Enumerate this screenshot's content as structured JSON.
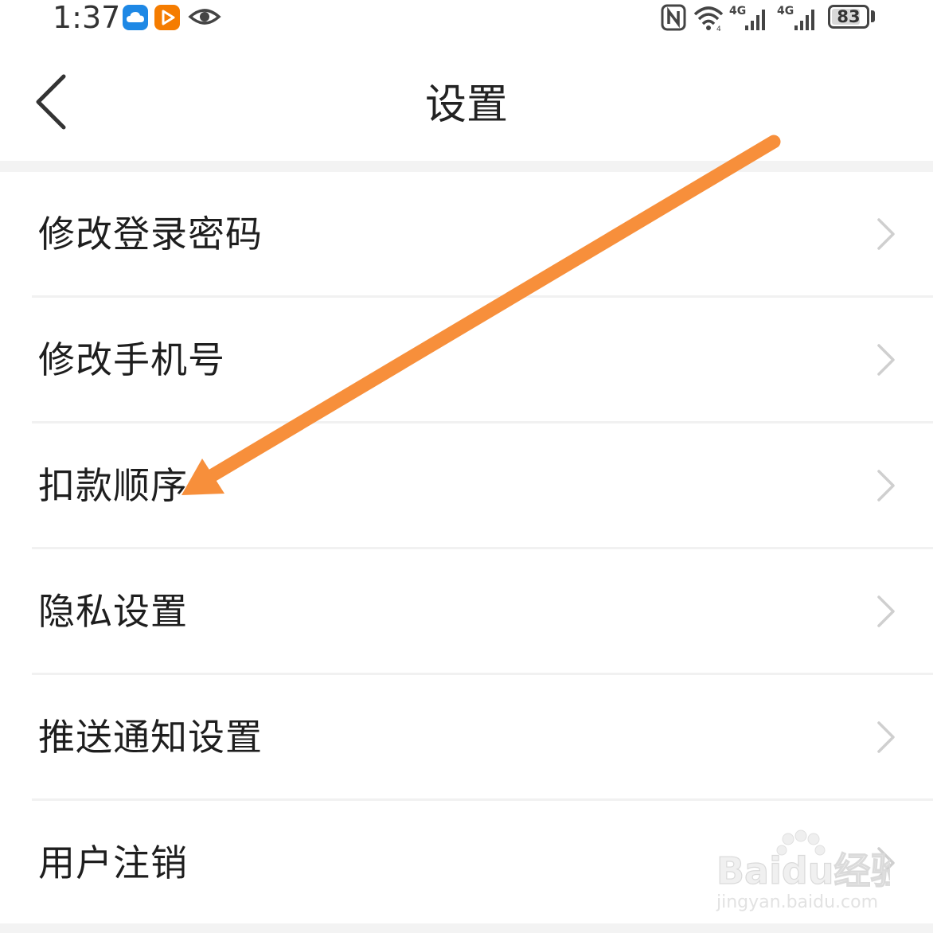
{
  "status_bar": {
    "time": "1:37",
    "battery_level": "83",
    "battery_fraction": 0.83,
    "network_label_1": "4G",
    "network_label_2": "4G",
    "icons": [
      "cloud-icon",
      "video-icon",
      "eye-icon",
      "nfc-icon",
      "wifi-icon",
      "signal-icon",
      "signal-icon",
      "battery-icon"
    ]
  },
  "nav": {
    "title": "设置",
    "back_icon": "back-icon"
  },
  "menu": {
    "items": [
      {
        "label": "修改登录密码"
      },
      {
        "label": "修改手机号"
      },
      {
        "label": "扣款顺序"
      },
      {
        "label": "隐私设置"
      },
      {
        "label": "推送通知设置"
      },
      {
        "label": "用户注销"
      }
    ],
    "chevron_icon": "chevron-right-icon"
  },
  "annotation": {
    "type": "arrow",
    "color": "#f78f3b",
    "points_to": "扣款顺序"
  },
  "watermark": {
    "logo_text": "Baidu经验",
    "url": "jingyan.baidu.com"
  }
}
